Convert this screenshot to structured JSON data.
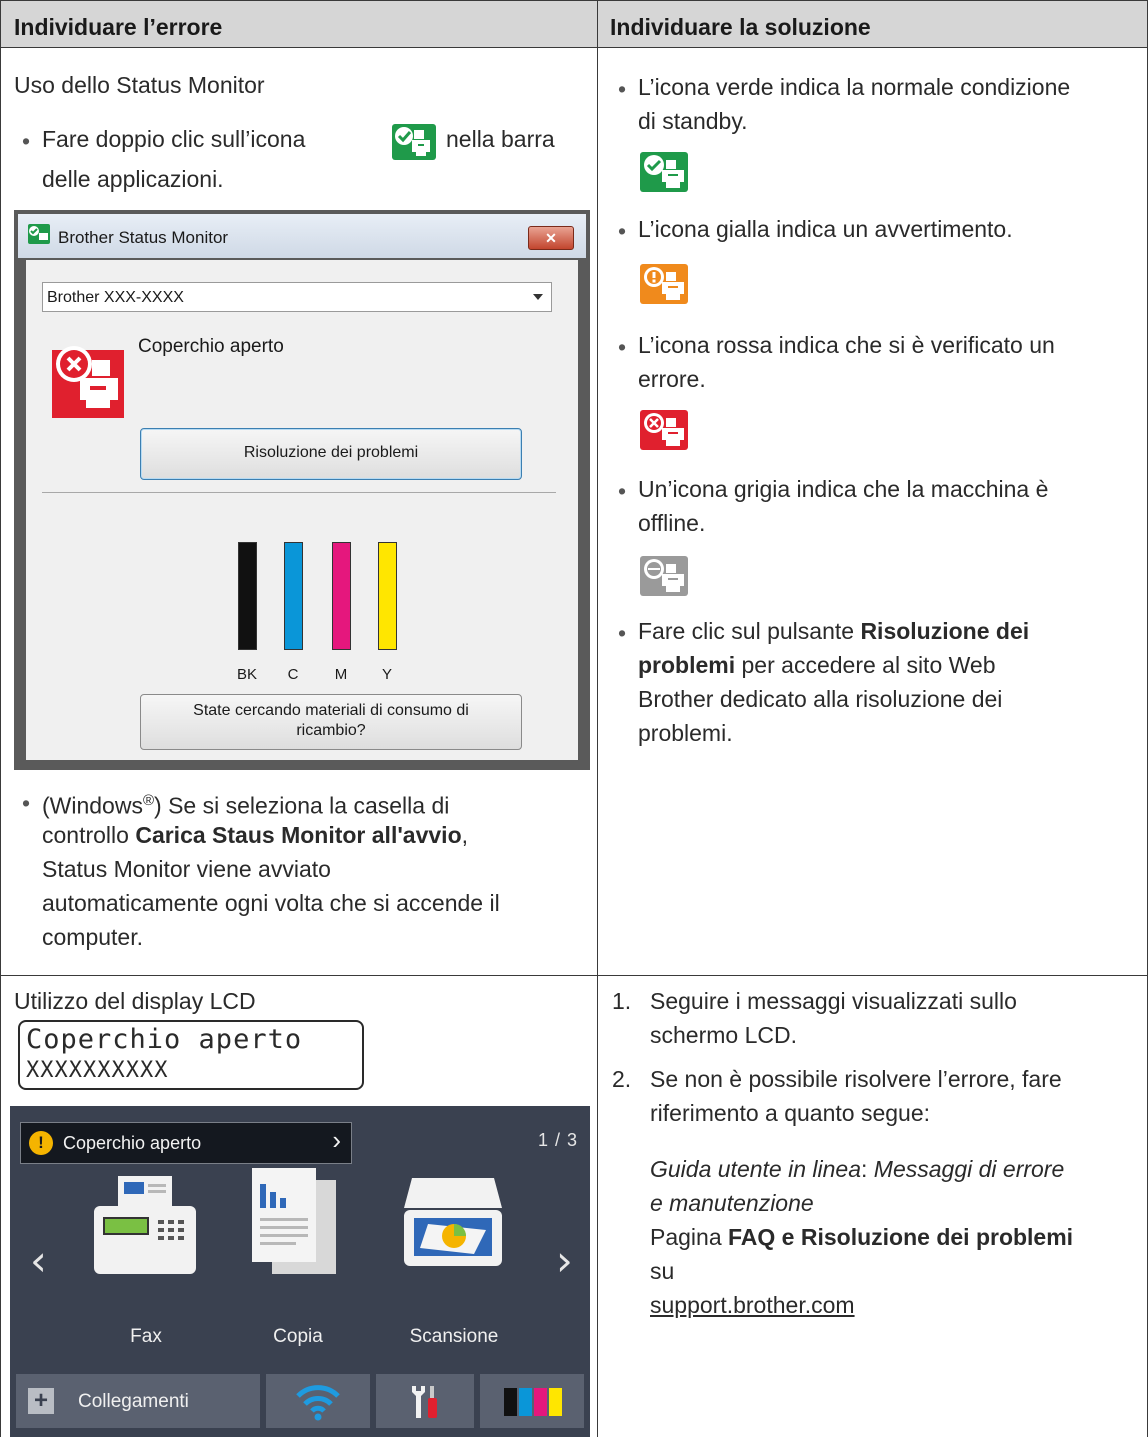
{
  "header": {
    "col1": "Individuare l’errore",
    "col2": "Individuare la soluzione"
  },
  "row1": {
    "left": {
      "title": "Uso dello Status Monitor",
      "bullet1_pre": "Fare doppio clic sull’icona",
      "bullet1_post": "nella barra",
      "bullet1_line2": "delle applicazioni.",
      "dialog": {
        "title": "Brother Status Monitor",
        "close": "✕",
        "model": "Brother XXX-XXXX",
        "status": "Coperchio aperto",
        "troubleshoot_button": "Risoluzione dei problemi",
        "ink_labels": [
          "BK",
          "C",
          "M",
          "Y"
        ],
        "supplies_button_line1": "State cercando materiali di consumo di",
        "supplies_button_line2": "ricambio?"
      },
      "bullet2": {
        "line1_pre": "(Windows",
        "line1_sup": "®",
        "line1_post": ") Se si seleziona la casella di",
        "line2_pre": "controllo ",
        "line2_bold": "Carica Staus Monitor all'avvio",
        "line2_post": ",",
        "line3": "Status Monitor viene avviato",
        "line4": "automaticamente ogni volta che si accende il",
        "line5": "computer."
      }
    },
    "right": {
      "green_line1": "L’icona verde indica la normale condizione",
      "green_line2": "di standby.",
      "yellow_line1": "L’icona gialla indica un avvertimento.",
      "red_line1": "L’icona rossa indica che si è verificato un",
      "red_line2": "errore.",
      "grey_line1": "Un’icona grigia indica che la macchina è",
      "grey_line2": "offline.",
      "click_pre": "Fare clic sul pulsante ",
      "click_bold1": "Risoluzione dei",
      "click_bold2": "problemi",
      "click_post2": " per accedere al sito Web",
      "click_line3": "Brother dedicato alla risoluzione dei",
      "click_line4": "problemi."
    }
  },
  "row2": {
    "left": {
      "title": "Utilizzo del display LCD",
      "lcd_line1": "Coperchio aperto",
      "lcd_line2": "XXXXXXXXXX",
      "touch": {
        "alert_icon": "!",
        "alert_text": "Coperchio aperto",
        "chevron": "›",
        "page": "1 / 3",
        "nav_left": "‹",
        "nav_right": "›",
        "apps": [
          "Fax",
          "Copia",
          "Scansione"
        ],
        "shortcuts": "Collegamenti",
        "plus": "+"
      }
    },
    "right": {
      "step1_num": "1.",
      "step1_line1": "Seguire i messaggi visualizzati sullo",
      "step1_line2": "schermo LCD.",
      "step2_num": "2.",
      "step2_line1": "Se non è possibile risolvere l’errore, fare",
      "step2_line2": "riferimento a quanto segue:",
      "ref_italic1": "Guida utente in linea",
      "ref_colon": ": ",
      "ref_italic2": "Messaggi di errore",
      "ref_italic3": "e manutenzione",
      "faq_pre": "Pagina ",
      "faq_bold": "FAQ e Risoluzione dei problemi",
      "faq_su": "su",
      "faq_link": "support.brother.com"
    }
  },
  "colors": {
    "header_bg": "#d6d6d6",
    "green_icon": "#1f9a4a",
    "yellow_icon": "#f08a1c",
    "red_icon": "#e0202e",
    "grey_icon": "#9a9a9a",
    "ink_bk": "#111111",
    "ink_c": "#0a96d8",
    "ink_m": "#e5177d",
    "ink_y": "#ffe600"
  }
}
